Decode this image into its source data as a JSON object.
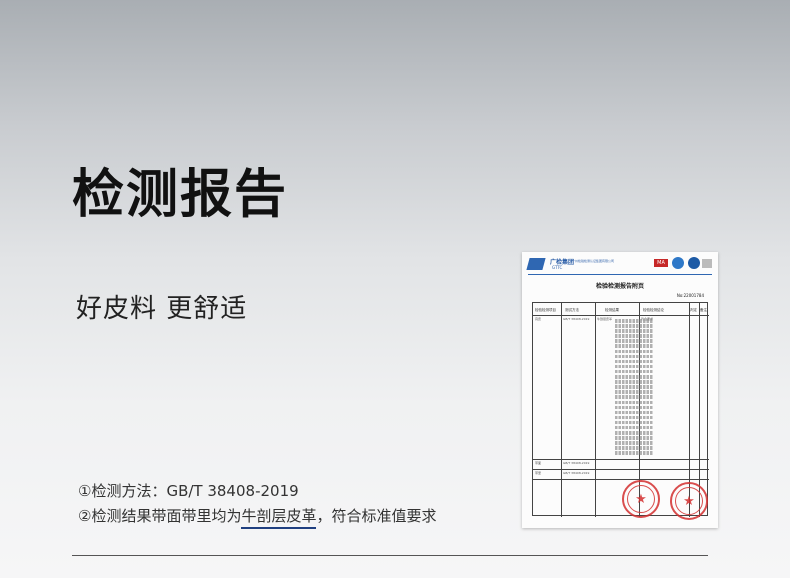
{
  "title": "检测报告",
  "subtitle": "好皮料 更舒适",
  "notes": {
    "line1": "①检测方法：GB/T 38408-2019",
    "line2_pre": "②检测结果带面带里均为",
    "line2_highlight": "牛剖层皮革",
    "line2_post": "，符合标准值要求"
  },
  "colors": {
    "underline": "#1f3f80",
    "brand_blue": "#2f67b2",
    "stamp_red": "#d32f2f"
  },
  "report": {
    "group_name": "广检集团",
    "group_abbr": "GTTC",
    "institute": "广州检验检测认证集团有限公司",
    "badge_ma": "MA",
    "heading": "检验检测报告附页",
    "report_no": "No:22001784",
    "headers": [
      "检验检测项目",
      "测试方法",
      "检测结果",
      "检验检测结论",
      "判定",
      "备注"
    ],
    "item_1": "真皮",
    "method_1": "GB/T 38408-2019",
    "result_1": "牛剖层皮革",
    "conclusion_1": "符合要求",
    "item_2": "带面",
    "item_3": "带里",
    "method_2": "GB/T 38408-2019",
    "method_3": "GB/T 38408-2019",
    "stamp_icon": "star-icon"
  }
}
